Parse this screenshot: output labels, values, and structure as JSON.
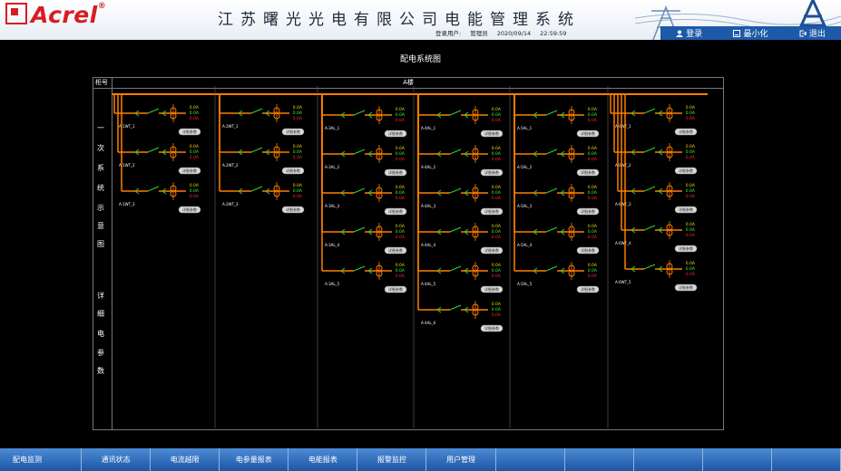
{
  "header": {
    "logo_text": "Acrel",
    "reg_mark": "®",
    "title": "江苏曙光光电有限公司电能管理系统"
  },
  "info": {
    "login_label": "登录用户:",
    "user": "管理员",
    "date": "2020/09/14",
    "time": "22:59:59"
  },
  "controls": {
    "login": "登录",
    "minimize": "最小化",
    "exit": "退出"
  },
  "diagram": {
    "title": "配电系统图",
    "cabinet_header": "柜号",
    "area_name": "A楼",
    "left_label_1": [
      "一",
      "次",
      "系",
      "统",
      "示",
      "意",
      "图"
    ],
    "left_label_2": [
      "详",
      "细",
      "电",
      "参",
      "数"
    ],
    "reading": "0.0A",
    "detail_label": "详细参数",
    "columns": [
      {
        "branches": [
          "A-1WT_1",
          "A-1WT_2",
          "A-1WT_3"
        ]
      },
      {
        "branches": [
          "A-2WT_1",
          "A-2WT_2",
          "A-2WT_3"
        ]
      },
      {
        "branches": [
          "A-3AL_1",
          "A-3AL_2",
          "A-3AL_3",
          "A-3AL_4",
          "A-3AL_5"
        ]
      },
      {
        "branches": [
          "A-4AL_1",
          "A-4AL_2",
          "A-4AL_3",
          "A-4AL_4",
          "A-4AL_5",
          "A-4AL_6"
        ]
      },
      {
        "branches": [
          "A-5AL_1",
          "A-5AL_2",
          "A-5AL_3",
          "A-5AL_4",
          "A-5AL_5"
        ]
      },
      {
        "branches": [
          "A-6WT_1",
          "A-6WT_2",
          "A-6WT_3",
          "A-6WT_4",
          "A-6WT_5"
        ]
      }
    ]
  },
  "nav": {
    "items": [
      "配电监测",
      "通讯状态",
      "电流越限",
      "电参量报表",
      "电能报表",
      "报警监控",
      "用户管理",
      "",
      "",
      "",
      "",
      ""
    ]
  },
  "colors": {
    "busbar": "#ff7f00",
    "switch": "#33cc33",
    "reading_red": "#ff2a2a",
    "reading_yellow": "#ffd700",
    "reading_green": "#33ff33",
    "nav": "#1f5fae"
  }
}
